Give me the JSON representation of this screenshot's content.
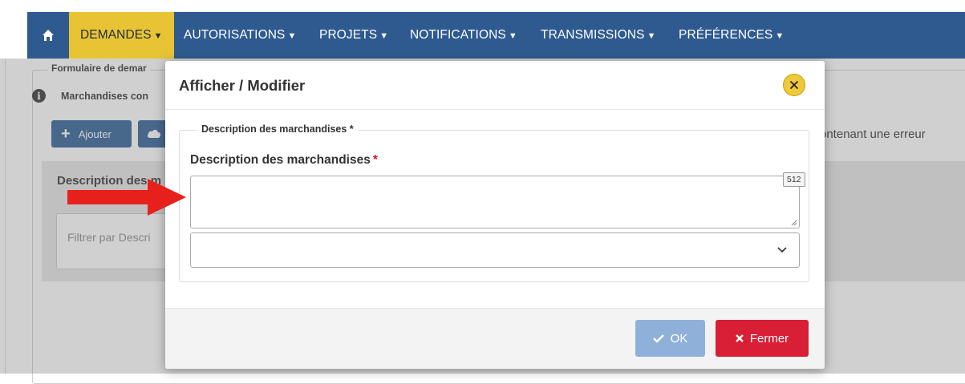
{
  "nav": {
    "home_icon": "home-icon",
    "items": [
      {
        "label": "DEMANDES",
        "active": true
      },
      {
        "label": "AUTORISATIONS"
      },
      {
        "label": "PROJETS"
      },
      {
        "label": "NOTIFICATIONS"
      },
      {
        "label": "TRANSMISSIONS"
      },
      {
        "label": "PRÉFÉRENCES"
      }
    ],
    "caret": "▼"
  },
  "background": {
    "legend": "Formulaire de demar",
    "info_text": "Marchandises con",
    "add_button": "Ajouter",
    "error_text": "ontenant une erreur",
    "column_title": "Description des m",
    "filter_placeholder": "Filtrer par Descri"
  },
  "modal": {
    "title": "Afficher / Modifier",
    "fieldset_legend": "Description des marchandises *",
    "field_label": "Description des marchandises",
    "required_mark": "*",
    "char_counter": "512",
    "textarea_value": "",
    "select_value": "",
    "ok_label": "OK",
    "close_label": "Fermer"
  },
  "colors": {
    "nav_bg": "#2f5a8f",
    "nav_active": "#e8c435",
    "ok_button": "#8fb1d9",
    "close_button": "#d81f35",
    "required": "#d0162b",
    "annotation_arrow": "#e8201c"
  }
}
